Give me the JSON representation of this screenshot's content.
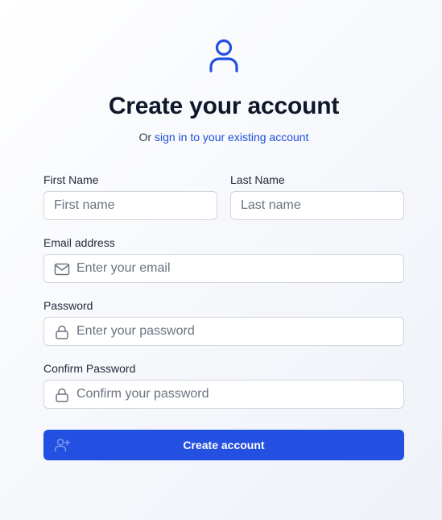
{
  "header": {
    "icon": "user-icon",
    "title": "Create your account",
    "subtitle_prefix": "Or",
    "signin_link": "sign in to your existing account"
  },
  "form": {
    "first_name": {
      "label": "First Name",
      "placeholder": "First name",
      "value": ""
    },
    "last_name": {
      "label": "Last Name",
      "placeholder": "Last name",
      "value": ""
    },
    "email": {
      "label": "Email address",
      "placeholder": "Enter your email",
      "value": "",
      "icon": "mail-icon"
    },
    "password": {
      "label": "Password",
      "placeholder": "Enter your password",
      "value": "",
      "icon": "lock-icon"
    },
    "confirm_password": {
      "label": "Confirm Password",
      "placeholder": "Confirm your password",
      "value": "",
      "icon": "lock-icon"
    },
    "submit": {
      "label": "Create account",
      "icon": "user-plus-icon"
    }
  },
  "colors": {
    "accent": "#2350e0",
    "link": "#1d4ed8",
    "title": "#0f172a",
    "border": "#d1d5db",
    "placeholder": "#6b7280"
  }
}
